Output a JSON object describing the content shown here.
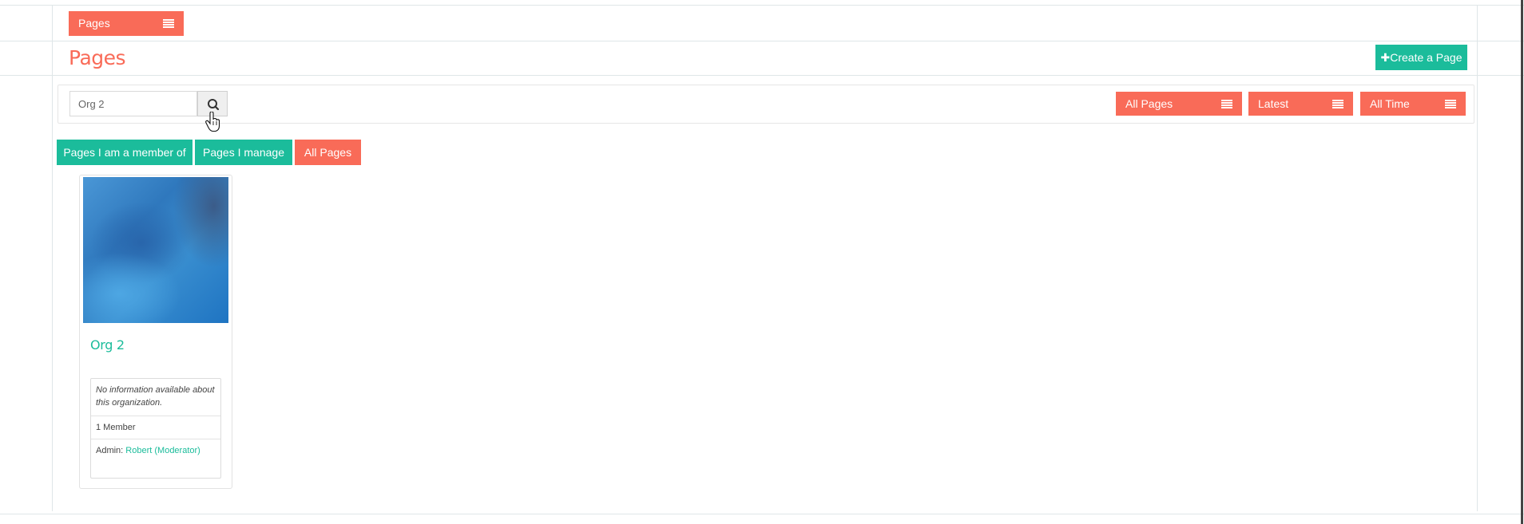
{
  "breadcrumb": {
    "label": "Pages"
  },
  "header": {
    "title": "Pages",
    "create_label": "Create a Page"
  },
  "search": {
    "value": "Org 2",
    "placeholder": ""
  },
  "filters": {
    "type_label": "All Pages",
    "sort_label": "Latest",
    "time_label": "All Time"
  },
  "tabs": [
    {
      "label": "Pages I am a member of",
      "active": false
    },
    {
      "label": "Pages I manage",
      "active": false
    },
    {
      "label": "All Pages",
      "active": true
    }
  ],
  "cards": [
    {
      "title": "Org 2",
      "description": "No information available about this organization.",
      "members": "1 Member",
      "admin_prefix": "Admin: ",
      "admin_name": "Robert (Moderator)"
    }
  ],
  "colors": {
    "accent": "#f96b58",
    "teal": "#1bbc9b",
    "border": "#dfe6e8"
  }
}
